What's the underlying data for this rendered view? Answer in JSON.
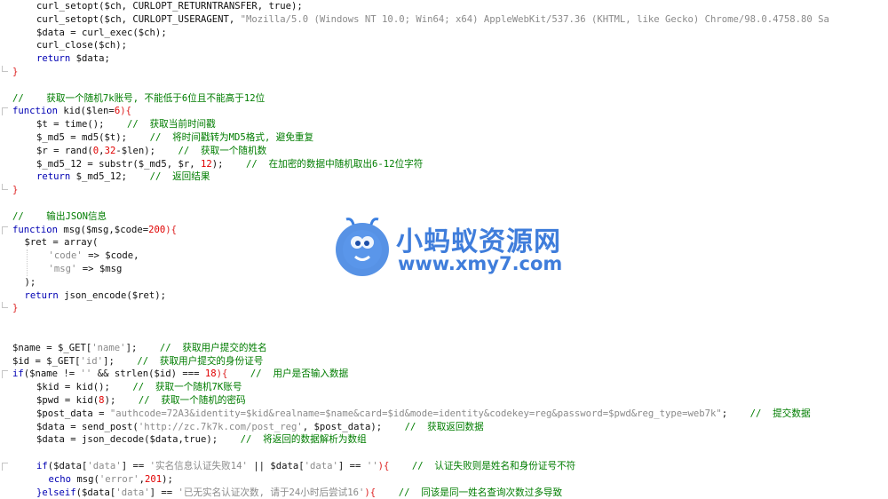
{
  "code_lines": [
    {
      "indent": 1,
      "fold": "",
      "segments": [
        {
          "t": "curl_setopt($ch, CURLOPT_RETURNTRANSFER, true);",
          "c": "var"
        }
      ]
    },
    {
      "indent": 1,
      "fold": "",
      "segments": [
        {
          "t": "curl_setopt($ch, CURLOPT_USERAGENT, ",
          "c": "var"
        },
        {
          "t": "\"Mozilla/5.0 (Windows NT 10.0; Win64; x64) AppleWebKit/537.36 (KHTML, like Gecko) Chrome/98.0.4758.80 Sa",
          "c": "str"
        }
      ]
    },
    {
      "indent": 1,
      "fold": "",
      "segments": [
        {
          "t": "$data = curl_exec($ch);",
          "c": "var"
        }
      ]
    },
    {
      "indent": 1,
      "fold": "",
      "segments": [
        {
          "t": "curl_close($ch);",
          "c": "var"
        }
      ]
    },
    {
      "indent": 1,
      "fold": "",
      "segments": [
        {
          "t": "return",
          "c": "kw"
        },
        {
          "t": " $data;",
          "c": "var"
        }
      ]
    },
    {
      "indent": 0,
      "fold": "end",
      "segments": [
        {
          "t": "}",
          "c": "br"
        }
      ]
    },
    {
      "indent": 0,
      "fold": "",
      "segments": []
    },
    {
      "indent": 0,
      "fold": "",
      "segments": [
        {
          "t": "//    获取一个随机7k账号, 不能低于6位且不能高于12位",
          "c": "com"
        }
      ]
    },
    {
      "indent": 0,
      "fold": "start",
      "segments": [
        {
          "t": "function",
          "c": "kw"
        },
        {
          "t": " kid($len=",
          "c": "var"
        },
        {
          "t": "6",
          "c": "num"
        },
        {
          "t": "){",
          "c": "br"
        }
      ]
    },
    {
      "indent": 1,
      "fold": "",
      "segments": [
        {
          "t": "$t = time();",
          "c": "var"
        },
        {
          "t": "    //  获取当前时间戳",
          "c": "com"
        }
      ]
    },
    {
      "indent": 1,
      "fold": "",
      "segments": [
        {
          "t": "$_md5 = md5($t);",
          "c": "var"
        },
        {
          "t": "    //  将时间戳转为MD5格式, 避免重复",
          "c": "com"
        }
      ]
    },
    {
      "indent": 1,
      "fold": "",
      "segments": [
        {
          "t": "$r = rand(",
          "c": "var"
        },
        {
          "t": "0",
          "c": "num"
        },
        {
          "t": ",",
          "c": "var"
        },
        {
          "t": "32",
          "c": "num"
        },
        {
          "t": "-$len);",
          "c": "var"
        },
        {
          "t": "    //  获取一个随机数",
          "c": "com"
        }
      ]
    },
    {
      "indent": 1,
      "fold": "",
      "segments": [
        {
          "t": "$_md5_12 = substr($_md5, $r, ",
          "c": "var"
        },
        {
          "t": "12",
          "c": "num"
        },
        {
          "t": ");",
          "c": "var"
        },
        {
          "t": "    //  在加密的数据中随机取出6-12位字符",
          "c": "com"
        }
      ]
    },
    {
      "indent": 1,
      "fold": "",
      "segments": [
        {
          "t": "return",
          "c": "kw"
        },
        {
          "t": " $_md5_12;",
          "c": "var"
        },
        {
          "t": "    //  返回结果",
          "c": "com"
        }
      ]
    },
    {
      "indent": 0,
      "fold": "end",
      "segments": [
        {
          "t": "}",
          "c": "br"
        }
      ]
    },
    {
      "indent": 0,
      "fold": "",
      "segments": []
    },
    {
      "indent": 0,
      "fold": "",
      "segments": [
        {
          "t": "//    输出JSON信息",
          "c": "com"
        }
      ]
    },
    {
      "indent": 0,
      "fold": "start",
      "segments": [
        {
          "t": "function",
          "c": "kw"
        },
        {
          "t": " msg($msg,$code=",
          "c": "var"
        },
        {
          "t": "200",
          "c": "num"
        },
        {
          "t": "){",
          "c": "br"
        }
      ]
    },
    {
      "indent": 0.5,
      "fold": "",
      "segments": [
        {
          "t": "$ret = array(",
          "c": "var"
        }
      ]
    },
    {
      "indent": 1.5,
      "fold": "",
      "segments": [
        {
          "t": "'code'",
          "c": "str"
        },
        {
          "t": " => $code,",
          "c": "var"
        }
      ]
    },
    {
      "indent": 1.5,
      "fold": "",
      "segments": [
        {
          "t": "'msg'",
          "c": "str"
        },
        {
          "t": " => $msg",
          "c": "var"
        }
      ]
    },
    {
      "indent": 0.5,
      "fold": "",
      "segments": [
        {
          "t": ");",
          "c": "var"
        }
      ]
    },
    {
      "indent": 0.5,
      "fold": "",
      "segments": [
        {
          "t": "return",
          "c": "kw"
        },
        {
          "t": " json_encode($ret);",
          "c": "var"
        }
      ]
    },
    {
      "indent": 0,
      "fold": "end",
      "segments": [
        {
          "t": "}",
          "c": "br"
        }
      ]
    },
    {
      "indent": 0,
      "fold": "",
      "segments": []
    },
    {
      "indent": 0,
      "fold": "",
      "segments": []
    },
    {
      "indent": 0,
      "fold": "",
      "segments": [
        {
          "t": "$name = $_GET[",
          "c": "var"
        },
        {
          "t": "'name'",
          "c": "str"
        },
        {
          "t": "];",
          "c": "var"
        },
        {
          "t": "    //  获取用户提交的姓名",
          "c": "com"
        }
      ]
    },
    {
      "indent": 0,
      "fold": "",
      "segments": [
        {
          "t": "$id = $_GET[",
          "c": "var"
        },
        {
          "t": "'id'",
          "c": "str"
        },
        {
          "t": "];",
          "c": "var"
        },
        {
          "t": "    //  获取用户提交的身份证号",
          "c": "com"
        }
      ]
    },
    {
      "indent": 0,
      "fold": "start",
      "segments": [
        {
          "t": "if",
          "c": "kw"
        },
        {
          "t": "($name != ",
          "c": "var"
        },
        {
          "t": "''",
          "c": "str"
        },
        {
          "t": " && strlen($id) === ",
          "c": "var"
        },
        {
          "t": "18",
          "c": "num"
        },
        {
          "t": "){",
          "c": "br"
        },
        {
          "t": "    //  用户是否输入数据",
          "c": "com"
        }
      ]
    },
    {
      "indent": 1,
      "fold": "",
      "segments": [
        {
          "t": "$kid = kid();",
          "c": "var"
        },
        {
          "t": "    //  获取一个随机7K账号",
          "c": "com"
        }
      ]
    },
    {
      "indent": 1,
      "fold": "",
      "segments": [
        {
          "t": "$pwd = kid(",
          "c": "var"
        },
        {
          "t": "8",
          "c": "num"
        },
        {
          "t": ");",
          "c": "var"
        },
        {
          "t": "    //  获取一个随机的密码",
          "c": "com"
        }
      ]
    },
    {
      "indent": 1,
      "fold": "",
      "segments": [
        {
          "t": "$post_data = ",
          "c": "var"
        },
        {
          "t": "\"authcode=72A3&identity=$kid&realname=$name&card=$id&mode=identity&codekey=reg&password=$pwd&reg_type=web7k\"",
          "c": "str"
        },
        {
          "t": ";",
          "c": "var"
        },
        {
          "t": "    //  提交数据",
          "c": "com"
        }
      ]
    },
    {
      "indent": 1,
      "fold": "",
      "segments": [
        {
          "t": "$data = send_post(",
          "c": "var"
        },
        {
          "t": "'http://zc.7k7k.com/post_reg'",
          "c": "str"
        },
        {
          "t": ", $post_data);",
          "c": "var"
        },
        {
          "t": "    //  获取返回数据",
          "c": "com"
        }
      ]
    },
    {
      "indent": 1,
      "fold": "",
      "segments": [
        {
          "t": "$data = json_decode($data,true);",
          "c": "var"
        },
        {
          "t": "    //  将返回的数据解析为数组",
          "c": "com"
        }
      ]
    },
    {
      "indent": 0,
      "fold": "",
      "segments": []
    },
    {
      "indent": 1,
      "fold": "start",
      "segments": [
        {
          "t": "if",
          "c": "kw"
        },
        {
          "t": "($data[",
          "c": "var"
        },
        {
          "t": "'data'",
          "c": "str"
        },
        {
          "t": "] == ",
          "c": "var"
        },
        {
          "t": "'实名信息认证失败14'",
          "c": "str"
        },
        {
          "t": " || $data[",
          "c": "var"
        },
        {
          "t": "'data'",
          "c": "str"
        },
        {
          "t": "] == ",
          "c": "var"
        },
        {
          "t": "''",
          "c": "str"
        },
        {
          "t": "){",
          "c": "br"
        },
        {
          "t": "    //  认证失败则是姓名和身份证号不符",
          "c": "com"
        }
      ]
    },
    {
      "indent": 1.5,
      "fold": "",
      "segments": [
        {
          "t": "echo",
          "c": "kw"
        },
        {
          "t": " msg(",
          "c": "var"
        },
        {
          "t": "'error'",
          "c": "str"
        },
        {
          "t": ",",
          "c": "var"
        },
        {
          "t": "201",
          "c": "num"
        },
        {
          "t": ");",
          "c": "var"
        }
      ]
    },
    {
      "indent": 1,
      "fold": "",
      "segments": [
        {
          "t": "}elseif",
          "c": "kw"
        },
        {
          "t": "($data[",
          "c": "var"
        },
        {
          "t": "'data'",
          "c": "str"
        },
        {
          "t": "] == ",
          "c": "var"
        },
        {
          "t": "'已无实名认证次数, 请于24小时后尝试16'",
          "c": "str"
        },
        {
          "t": "){",
          "c": "br"
        },
        {
          "t": "    //  同该是同一姓名查询次数过多导致",
          "c": "com"
        }
      ]
    }
  ],
  "watermark": {
    "name_cn": "小蚂蚁资源网",
    "url": "www.xmy7.com",
    "logo_icon": "ant-logo-icon",
    "color": "#2f73d8"
  },
  "colors": {
    "keyword": "#0000b3",
    "variable": "#111111",
    "string": "#8a8a8a",
    "number": "#e00000",
    "comment": "#007d00",
    "brace": "#dd2222"
  }
}
